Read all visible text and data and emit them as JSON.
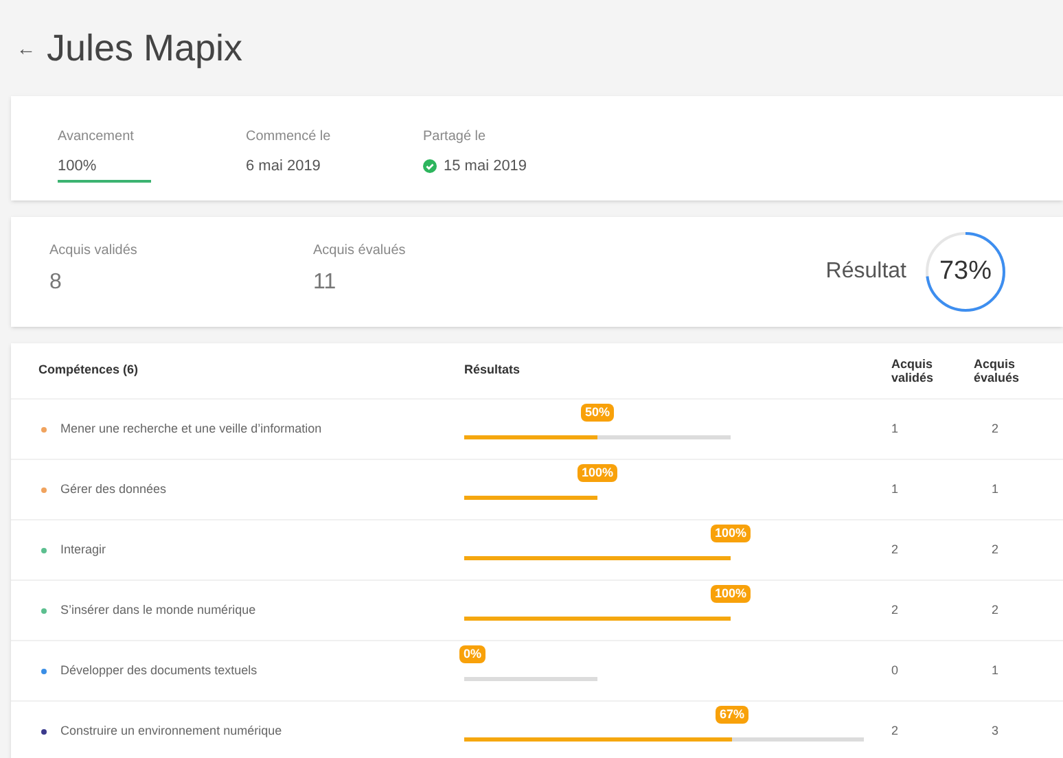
{
  "header": {
    "back": "←",
    "title": "Jules Mapix"
  },
  "summary": {
    "progress": {
      "label": "Avancement",
      "value": "100%",
      "level": 1
    },
    "started": {
      "label": "Commencé le",
      "value": "6 mai 2019"
    },
    "shared": {
      "label": "Partagé le",
      "value": "15 mai 2019",
      "validated": true
    }
  },
  "stats": [
    {
      "label": "Acquis validés",
      "value": "8"
    },
    {
      "label": "Acquis évalués",
      "value": "11"
    }
  ],
  "result": {
    "label": "Résultat",
    "value": "73%",
    "level": 0.73
  },
  "table": {
    "columns": [
      "Compétences (6)",
      "Résultats",
      "Acquis validés",
      "Acquis évalués"
    ],
    "rows": [
      {
        "name": "Mener une recherche et une veille d’information",
        "color": "#f0a35e",
        "level": 0.5,
        "badge": "50%",
        "validated": "1",
        "evaluated": "2"
      },
      {
        "name": "Gérer des données",
        "color": "#f0a35e",
        "level": 1,
        "badge": "100%",
        "validated": "1",
        "evaluated": "1"
      },
      {
        "name": "Interagir",
        "color": "#5cbf8f",
        "level": 1,
        "badge": "100%",
        "validated": "2",
        "evaluated": "2"
      },
      {
        "name": "S’insérer dans le monde numérique",
        "color": "#5cbf8f",
        "level": 1,
        "badge": "100%",
        "validated": "2",
        "evaluated": "2"
      },
      {
        "name": "Développer des documents textuels",
        "color": "#3a8ee6",
        "level": 0,
        "badge": "0%",
        "validated": "0",
        "evaluated": "1"
      },
      {
        "name": "Construire un environnement numérique",
        "color": "#3b3a8c",
        "level": 0.67,
        "badge": "67%",
        "validated": "2",
        "evaluated": "3"
      }
    ]
  }
}
